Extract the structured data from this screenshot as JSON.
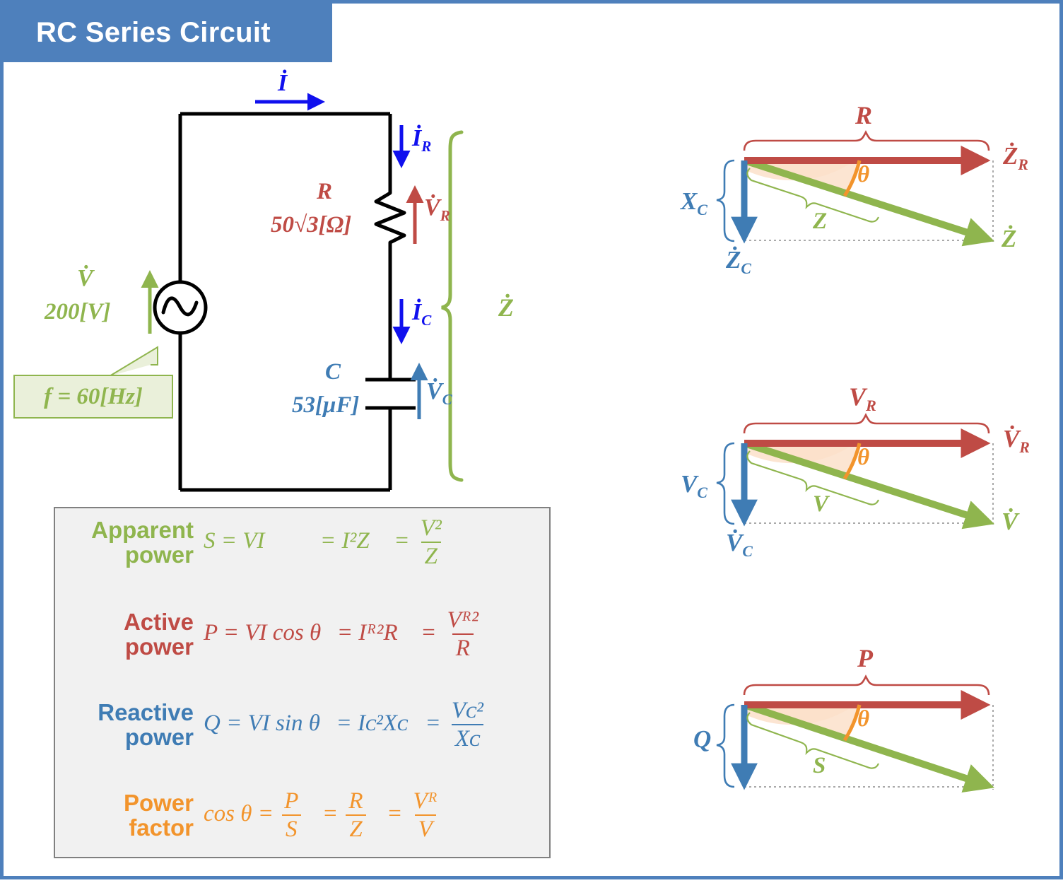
{
  "header": {
    "title": "RC Series Circuit",
    "bar_color": "#4E80BC"
  },
  "palette": {
    "green": "#8FB54E",
    "red": "#BF4B45",
    "blue": "#3F7CB4",
    "bright_blue": "#1010EE",
    "orange": "#F2942C",
    "sector_fill": "#FBE0CA",
    "box_bg": "#F1F1F1",
    "box_border": "#808080",
    "callout_bg": "#EAF0DA"
  },
  "circuit": {
    "current_total": "İ",
    "current_R": "İ",
    "current_R_sub": "R",
    "current_C": "İ",
    "current_C_sub": "C",
    "source_symbol": "∿",
    "source_label": "V̇",
    "source_value": "200[V]",
    "frequency": "f = 60[Hz]",
    "resistor_name": "R",
    "resistor_value": "50√3[Ω]",
    "resistor_voltage": "V̇",
    "resistor_voltage_sub": "R",
    "capacitor_name": "C",
    "capacitor_value": "53[μF]",
    "capacitor_voltage": "V̇",
    "capacitor_voltage_sub": "C",
    "impedance_brace_label": "Ż"
  },
  "formulas": [
    {
      "name_line1": "Apparent",
      "name_line2": "power",
      "color": "#8FB54E",
      "lhs": "S = VI",
      "mid": "= I²Z",
      "frac_prefix": "=",
      "frac_num": "V²",
      "frac_den": "Z"
    },
    {
      "name_line1": "Active",
      "name_line2": "power",
      "color": "#BF4B45",
      "lhs": "P = VI cos θ",
      "mid": "= Iᴿ²R",
      "frac_prefix": "=",
      "frac_num": "Vᴿ²",
      "frac_den": "R"
    },
    {
      "name_line1": "Reactive",
      "name_line2": "power",
      "color": "#3F7CB4",
      "lhs": "Q = VI sin θ",
      "mid": "= Iᴄ²Xᴄ",
      "frac_prefix": "=",
      "frac_num": "Vᴄ²",
      "frac_den": "Xᴄ"
    },
    {
      "name_line1": "Power",
      "name_line2": "factor",
      "color": "#F2942C",
      "lhs": "cos θ =",
      "mid": "",
      "frac_prefix": "",
      "frac_num": "P",
      "frac_den": "S",
      "frac2_prefix": "=",
      "frac2_num": "R",
      "frac2_den": "Z",
      "frac3_prefix": "=",
      "frac3_num": "Vᴿ",
      "frac3_den": "V"
    }
  ],
  "chart_data": {
    "type": "vector-diagram-set",
    "title": "RC series circuit phasor / triangle diagrams",
    "diagrams": [
      {
        "name": "impedance-triangle",
        "horizontal_vector_label": "Ż",
        "horizontal_vector_sub": "R",
        "horizontal_brace_label": "R",
        "vertical_vector_label": "Ż",
        "vertical_vector_sub": "C",
        "vertical_brace_label": "X",
        "vertical_brace_sub": "C",
        "resultant_label": "Ż",
        "resultant_brace_label": "Z",
        "angle_label": "θ",
        "horizontal_color": "#BF4B45",
        "vertical_color": "#3F7CB4",
        "resultant_color": "#8FB54E",
        "angle_color": "#F2942C"
      },
      {
        "name": "voltage-triangle",
        "horizontal_vector_label": "V̇",
        "horizontal_vector_sub": "R",
        "horizontal_brace_label": "V",
        "horizontal_brace_sub": "R",
        "vertical_vector_label": "V̇",
        "vertical_vector_sub": "C",
        "vertical_brace_label": "V",
        "vertical_brace_sub": "C",
        "resultant_label": "V̇",
        "resultant_brace_label": "V",
        "angle_label": "θ",
        "horizontal_color": "#BF4B45",
        "vertical_color": "#3F7CB4",
        "resultant_color": "#8FB54E",
        "angle_color": "#F2942C"
      },
      {
        "name": "power-triangle",
        "horizontal_vector_label": "",
        "horizontal_brace_label": "P",
        "vertical_vector_label": "",
        "vertical_brace_label": "Q",
        "resultant_label": "",
        "resultant_brace_label": "S",
        "angle_label": "θ",
        "horizontal_color": "#BF4B45",
        "vertical_color": "#3F7CB4",
        "resultant_color": "#8FB54E",
        "angle_color": "#F2942C"
      }
    ]
  }
}
